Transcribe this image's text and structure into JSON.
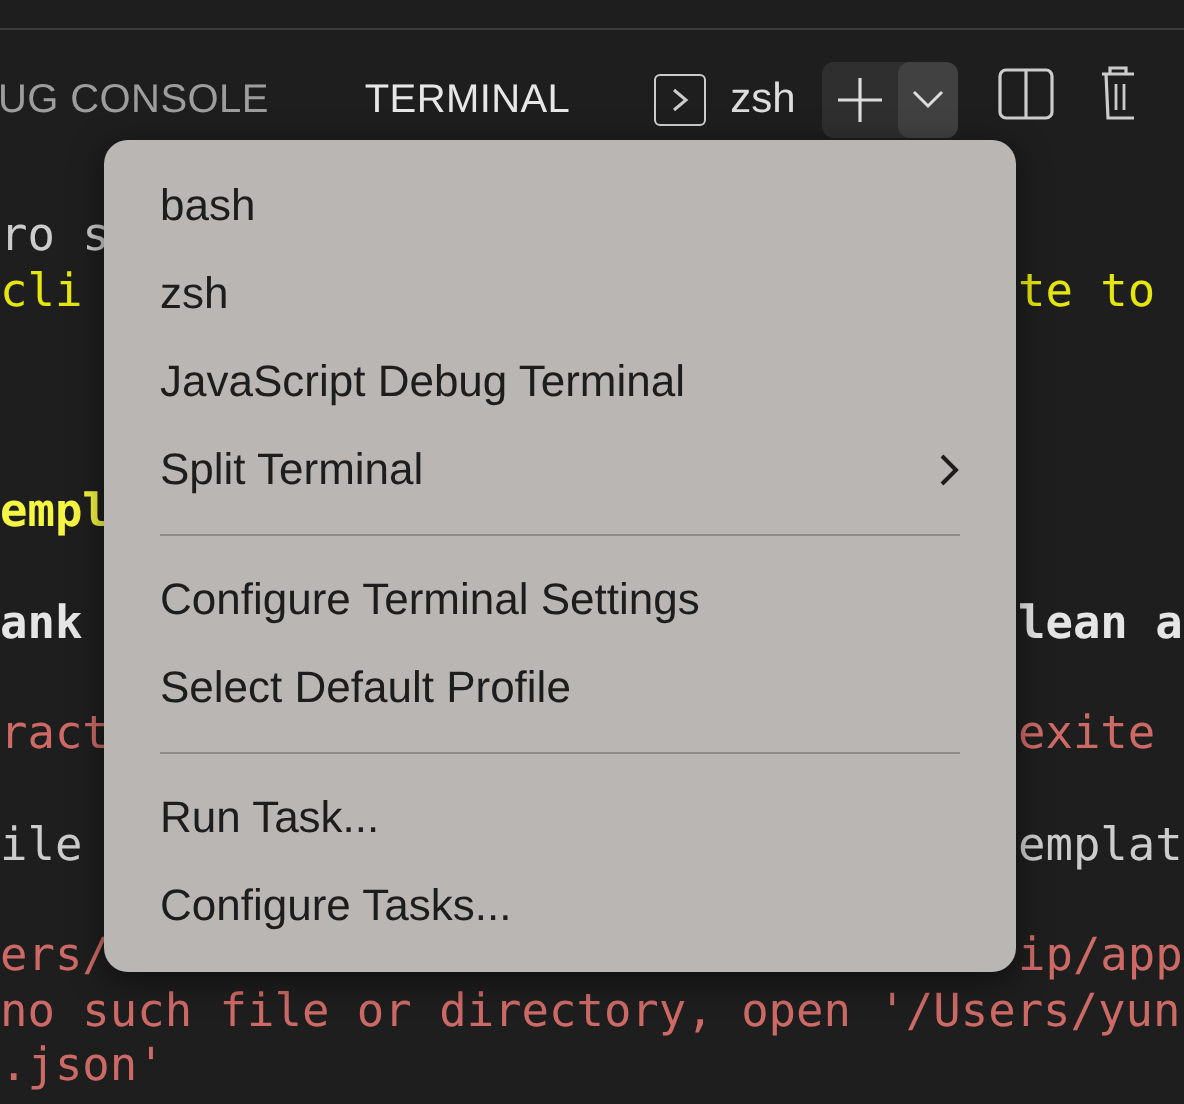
{
  "panel_tabs": [
    {
      "label": "UG CONSOLE",
      "selected": false
    },
    {
      "label": "TERMINAL",
      "selected": true
    }
  ],
  "terminal_selector": {
    "label": "zsh"
  },
  "terminal_lines": [
    {
      "kind": "text",
      "left": "ro s",
      "color": "#cccccc",
      "bold": false
    },
    {
      "kind": "text",
      "left": "cli",
      "right": "te to",
      "color": "#e5e510",
      "bold": false
    },
    {
      "kind": "blank"
    },
    {
      "kind": "blank"
    },
    {
      "kind": "blank"
    },
    {
      "kind": "text",
      "left": "empl",
      "color": "#f5f543",
      "bold": true
    },
    {
      "kind": "blank"
    },
    {
      "kind": "text",
      "left": "ank",
      "right": "lean a",
      "color": "#e5e5e5",
      "bold": true
    },
    {
      "kind": "blank"
    },
    {
      "kind": "text",
      "left": "ract",
      "right": "exite",
      "color": "#cd6a66",
      "bold": false
    },
    {
      "kind": "blank"
    },
    {
      "kind": "text",
      "left": "ile",
      "right": "emplat",
      "color": "#cccccc",
      "bold": false
    },
    {
      "kind": "blank"
    },
    {
      "kind": "text",
      "left": "ers/",
      "right": "ip/app",
      "color": "#cd6a66",
      "bold": false
    },
    {
      "kind": "text",
      "left": "no such file or directory, open '/Users/yun",
      "color": "#cd6a66",
      "bold": false
    },
    {
      "kind": "text",
      "left": ".json'",
      "color": "#cd6a66",
      "bold": false
    }
  ],
  "menu": [
    {
      "kind": "item",
      "label": "bash",
      "submenu": false
    },
    {
      "kind": "item",
      "label": "zsh",
      "submenu": false
    },
    {
      "kind": "item",
      "label": "JavaScript Debug Terminal",
      "submenu": false
    },
    {
      "kind": "item",
      "label": "Split Terminal",
      "submenu": true
    },
    {
      "kind": "separator"
    },
    {
      "kind": "item",
      "label": "Configure Terminal Settings",
      "submenu": false
    },
    {
      "kind": "item",
      "label": "Select Default Profile",
      "submenu": false
    },
    {
      "kind": "separator"
    },
    {
      "kind": "item",
      "label": "Run Task...",
      "submenu": false
    },
    {
      "kind": "item",
      "label": "Configure Tasks...",
      "submenu": false
    }
  ]
}
